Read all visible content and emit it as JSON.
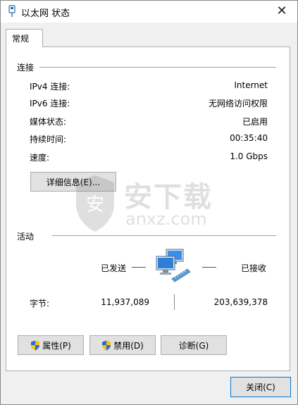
{
  "window": {
    "title": "以太网 状态",
    "close_glyph": "✕"
  },
  "tabs": [
    {
      "label": "常规"
    }
  ],
  "connection": {
    "header": "连接",
    "rows": [
      {
        "label": "IPv4 连接:",
        "value": "Internet"
      },
      {
        "label": "IPv6 连接:",
        "value": "无网络访问权限"
      },
      {
        "label": "媒体状态:",
        "value": "已启用"
      },
      {
        "label": "持续时间:",
        "value": "00:35:40"
      },
      {
        "label": "速度:",
        "value": "1.0 Gbps"
      }
    ],
    "details_button": "详细信息(E)..."
  },
  "activity": {
    "header": "活动",
    "sent_label": "已发送",
    "received_label": "已接收",
    "bytes_label": "字节:",
    "bytes_sent": "11,937,089",
    "bytes_received": "203,639,378"
  },
  "buttons": {
    "properties": "属性(P)",
    "disable": "禁用(D)",
    "diagnose": "诊断(G)",
    "close": "关闭(C)"
  },
  "watermark": {
    "text": "安下载",
    "url": "anxz.com"
  },
  "colors": {
    "accent": "#0078d7",
    "shield_blue": "#2f6ac8",
    "shield_yellow": "#f3c318"
  }
}
